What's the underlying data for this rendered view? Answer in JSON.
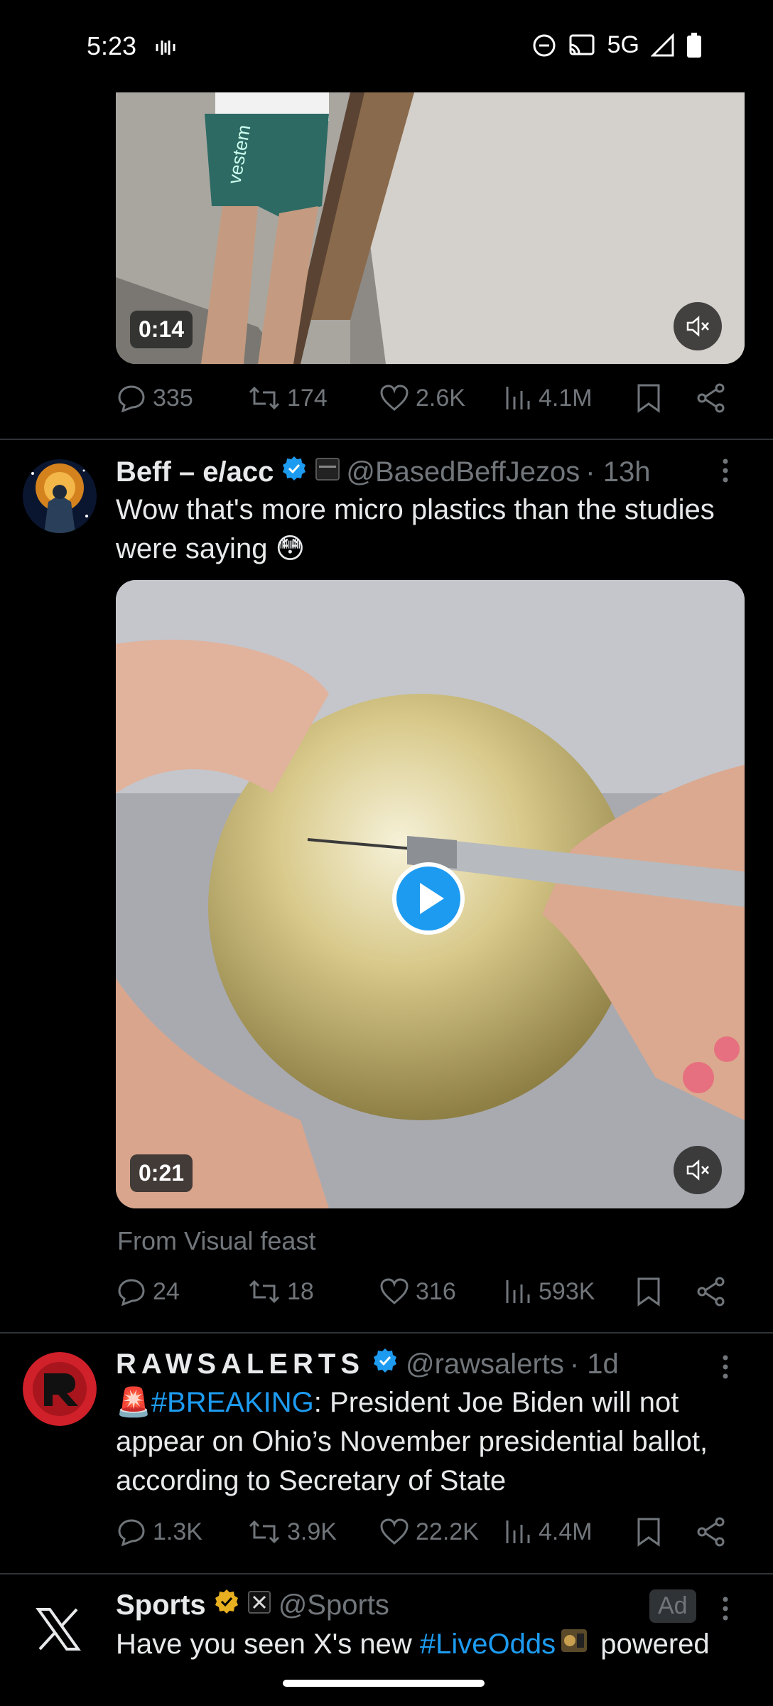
{
  "status_bar": {
    "time": "5:23",
    "network": "5G"
  },
  "tweets": [
    {
      "video_time": "0:14",
      "actions": {
        "replies": "335",
        "reposts": "174",
        "likes": "2.6K",
        "views": "4.1M"
      }
    },
    {
      "name": "Beff – e/acc",
      "handle": "@BasedBeffJezos",
      "time": "· 13h",
      "text": "Wow that's more micro plastics than the studies were saying 😳",
      "video_time": "0:21",
      "source": "From Visual feast",
      "actions": {
        "replies": "24",
        "reposts": "18",
        "likes": "316",
        "views": "593K"
      }
    },
    {
      "name": "RAWSALERTS",
      "handle": "@rawsalerts",
      "time": "· 1d",
      "emoji": "🚨",
      "hashtag": "#BREAKING",
      "text": ": President Joe Biden will not appear on Ohio’s November presidential ballot, according to Secretary of State",
      "actions": {
        "replies": "1.3K",
        "reposts": "3.9K",
        "likes": "22.2K",
        "views": "4.4M"
      }
    },
    {
      "name": "Sports",
      "handle": "@Sports",
      "ad_label": "Ad",
      "text_prefix": "Have you seen X's new ",
      "hashtag": "#LiveOdds",
      "text_suffix": " powered"
    }
  ],
  "colors": {
    "accent": "#1d9bf0",
    "muted": "#71767b",
    "gold": "#e8b020"
  }
}
